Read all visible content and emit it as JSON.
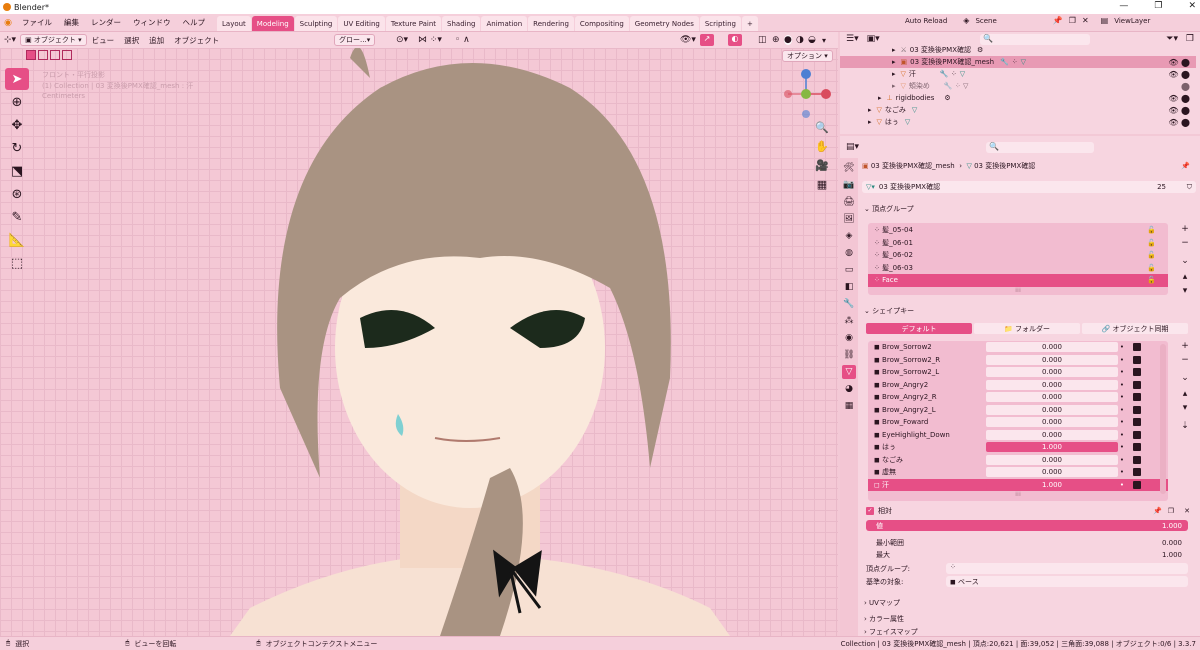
{
  "title_bar": {
    "title": "Blender*"
  },
  "menu": {
    "items": [
      "ファイル",
      "編集",
      "レンダー",
      "ウィンドウ",
      "ヘルプ"
    ]
  },
  "workspace_tabs": [
    {
      "label": "Layout"
    },
    {
      "label": "Modeling"
    },
    {
      "label": "Sculpting"
    },
    {
      "label": "UV Editing"
    },
    {
      "label": "Texture Paint"
    },
    {
      "label": "Shading"
    },
    {
      "label": "Animation"
    },
    {
      "label": "Rendering"
    },
    {
      "label": "Compositing"
    },
    {
      "label": "Geometry Nodes"
    },
    {
      "label": "Scripting"
    }
  ],
  "active_tab": "Modeling",
  "topright": {
    "auto_reload": "Auto Reload",
    "scene": "Scene",
    "view_layer": "ViewLayer"
  },
  "viewport_header": {
    "mode": "オブジェクト",
    "menus": [
      "ビュー",
      "選択",
      "追加",
      "オブジェクト"
    ],
    "orientation": "グロー...",
    "options": "オプション"
  },
  "viewport_overlay": {
    "line1": "フロント・平行投影",
    "line2": "(1) Collection | 03 変換後PMX確認_mesh : 汗",
    "line3": "Centimeters"
  },
  "outliner": {
    "rows": [
      {
        "label": "03 変換後PMX確認"
      },
      {
        "label": "03 変換後PMX確認_mesh"
      },
      {
        "label": "汗"
      },
      {
        "label": "頬染め"
      },
      {
        "label": "rigidbodies"
      },
      {
        "label": "なごみ"
      },
      {
        "label": "はぅ"
      }
    ]
  },
  "properties": {
    "breadcrumb_object": "03 変換後PMX確認_mesh",
    "breadcrumb_data": "03 変換後PMX確認",
    "data_name": "03 変換後PMX確認",
    "user_count": "25",
    "vertex_groups": {
      "header": "頂点グループ",
      "items": [
        "髪_05-04",
        "髪_06-01",
        "髪_06-02",
        "髪_06-03",
        "Face"
      ],
      "selected": "Face"
    },
    "shape_keys": {
      "header": "シェイプキー",
      "tabs": [
        "デフォルト",
        "フォルダー",
        "オブジェクト同期"
      ],
      "items": [
        {
          "name": "Brow_Sorrow2",
          "value": "0.000"
        },
        {
          "name": "Brow_Sorrow2_R",
          "value": "0.000"
        },
        {
          "name": "Brow_Sorrow2_L",
          "value": "0.000"
        },
        {
          "name": "Brow_Angry2",
          "value": "0.000"
        },
        {
          "name": "Brow_Angry2_R",
          "value": "0.000"
        },
        {
          "name": "Brow_Angry2_L",
          "value": "0.000"
        },
        {
          "name": "Brow_Foward",
          "value": "0.000"
        },
        {
          "name": "EyeHighlight_Down",
          "value": "0.000"
        },
        {
          "name": "はぅ",
          "value": "1.000"
        },
        {
          "name": "なごみ",
          "value": "0.000"
        },
        {
          "name": "虚無",
          "value": "0.000"
        },
        {
          "name": "汗",
          "value": "1.000"
        }
      ],
      "selected": "汗"
    },
    "relative": {
      "label": "相対",
      "value_label": "値",
      "value": "1.000",
      "min_label": "最小範囲",
      "min": "0.000",
      "max_label": "最大",
      "max": "1.000",
      "vgroup_label": "頂点グループ:",
      "relative_to_label": "基準の対象:",
      "relative_to": "ベース"
    },
    "sections": [
      "UVマップ",
      "カラー属性",
      "フェイスマップ"
    ]
  },
  "status_bar": {
    "left1": "選択",
    "left2": "ビューを回転",
    "left3": "オブジェクトコンテクストメニュー",
    "right": "Collection | 03 変換後PMX確認_mesh | 頂点:20,621 | 面:39,052 | 三角面:39,088 | オブジェクト:0/6 | 3.3.7"
  },
  "colors": {
    "accent": "#e64f86",
    "panel": "#f7d5e0",
    "viewport": "#f4c8d5"
  }
}
